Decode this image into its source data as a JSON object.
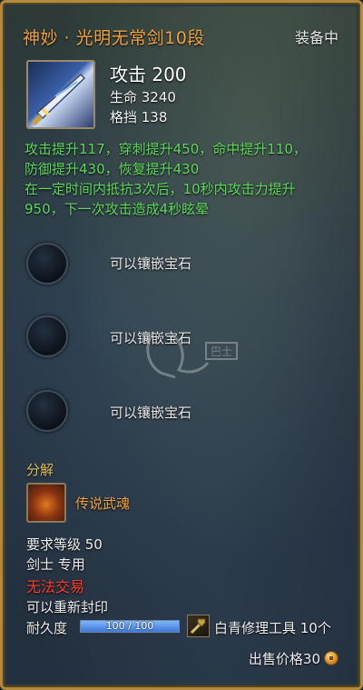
{
  "item": {
    "name": "神妙 · 光明无常剑10段",
    "equip_state": "装备中",
    "attack": "攻击 200",
    "hp": "生命 3240",
    "block": "格挡 138",
    "icon": "sword-icon"
  },
  "bonuses": [
    "攻击提升117，穿刺提升450，命中提升110，",
    "防御提升430，恢复提升430",
    "在一定时间内抵抗3次后，10秒内攻击力提升",
    "950，下一次攻击造成4秒眩晕"
  ],
  "sockets": [
    {
      "label": "可以镶嵌宝石"
    },
    {
      "label": "可以镶嵌宝石"
    },
    {
      "label": "可以镶嵌宝石"
    }
  ],
  "watermark": {
    "text": "巴士",
    "icon": "watermark-logo-icon"
  },
  "dismantle": {
    "label": "分解",
    "result": "传说武魂",
    "icon": "martial-soul-icon"
  },
  "requirements": {
    "level": "要求等级 50",
    "class": "剑士 专用",
    "trade": "无法交易",
    "reseal": "可以重新封印"
  },
  "durability": {
    "label": "耐久度",
    "text": "100 / 100",
    "current": 100,
    "max": 100
  },
  "repair": {
    "text": "白青修理工具 10个",
    "icon": "repair-tool-icon"
  },
  "price": {
    "text": "出售价格30",
    "icon": "copper-coin-icon"
  },
  "colors": {
    "title": "#f0a040",
    "bonus": "#5ed85c",
    "warning": "#ff3a2a",
    "frame": "#b08a3e"
  }
}
